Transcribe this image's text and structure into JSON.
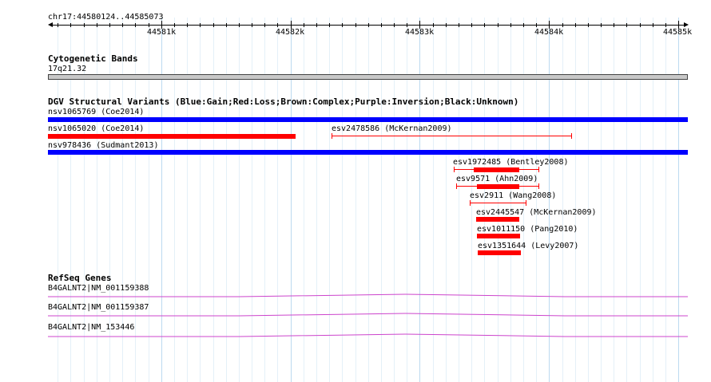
{
  "ruler": {
    "region": "chr17:44580124..44585073",
    "ticks": [
      "44581k",
      "44582k",
      "44583k",
      "44584k",
      "44585k"
    ]
  },
  "cytoband": {
    "title": "Cytogenetic Bands",
    "band": "17q21.32"
  },
  "dgv": {
    "title": "DGV Structural Variants (Blue:Gain;Red:Loss;Brown:Complex;Purple:Inversion;Black:Unknown)",
    "colors": {
      "gain": "#0000ff",
      "loss": "#ff0000"
    },
    "variants": [
      {
        "label": "nsv1065769 (Coe2014)",
        "type": "gain"
      },
      {
        "label": "nsv1065020 (Coe2014)",
        "type": "loss"
      },
      {
        "label": "esv2478586 (McKernan2009)",
        "type": "loss"
      },
      {
        "label": "nsv978436 (Sudmant2013)",
        "type": "gain"
      },
      {
        "label": "esv1972485 (Bentley2008)",
        "type": "loss"
      },
      {
        "label": "esv9571 (Ahn2009)",
        "type": "loss"
      },
      {
        "label": "esv2911 (Wang2008)",
        "type": "loss"
      },
      {
        "label": "esv2445547 (McKernan2009)",
        "type": "loss"
      },
      {
        "label": "esv1011150 (Pang2010)",
        "type": "loss"
      },
      {
        "label": "esv1351644 (Levy2007)",
        "type": "loss"
      }
    ]
  },
  "refseq": {
    "title": "RefSeq Genes",
    "color": "#cc44cc",
    "genes": [
      {
        "label": "B4GALNT2|NM_001159388"
      },
      {
        "label": "B4GALNT2|NM_001159387"
      },
      {
        "label": "B4GALNT2|NM_153446"
      }
    ]
  }
}
